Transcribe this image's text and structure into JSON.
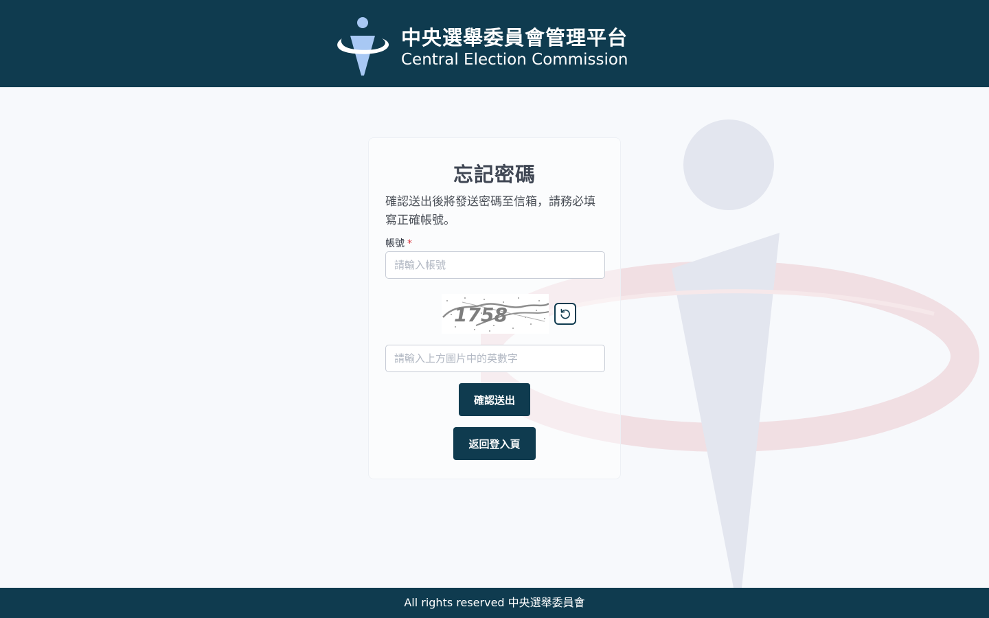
{
  "header": {
    "title_zh": "中央選舉委員會管理平台",
    "title_en": "Central Election Commission"
  },
  "form": {
    "title": "忘記密碼",
    "description": "確認送出後將發送密碼至信箱，請務必填寫正確帳號。",
    "account_label": "帳號",
    "required_mark": "*",
    "account_placeholder": "請輸入帳號",
    "captcha_text": "1758",
    "captcha_placeholder": "請輸入上方圖片中的英數字",
    "refresh_icon": "refresh-icon",
    "submit_label": "確認送出",
    "back_label": "返回登入頁"
  },
  "footer": {
    "text": "All rights reserved 中央選舉委員會"
  },
  "colors": {
    "brand": "#0f3b4f",
    "background": "#f7f9fc",
    "required": "#d9363e",
    "accent_blue": "#a8c8f4"
  }
}
